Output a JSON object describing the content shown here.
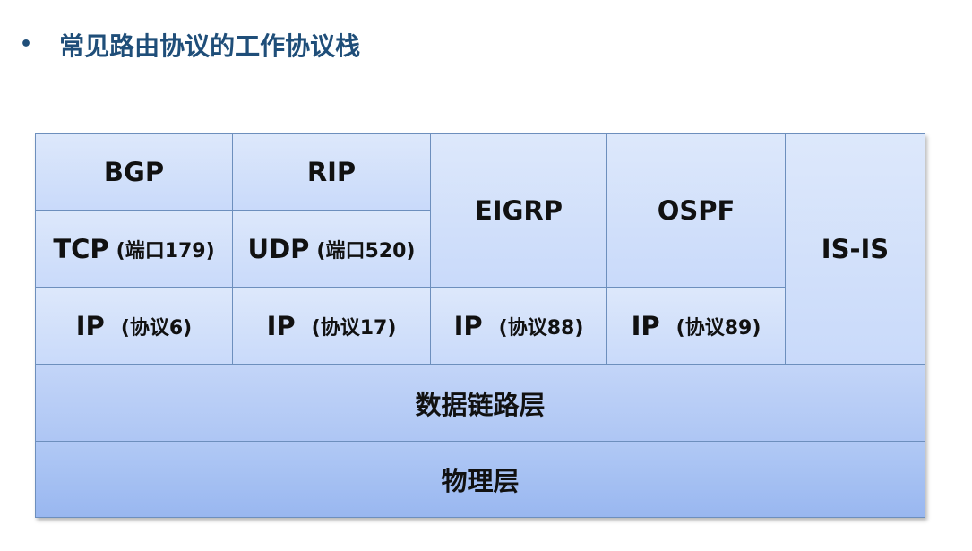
{
  "title": {
    "bullet": "•",
    "text": "常见路由协议的工作协议栈"
  },
  "stack": {
    "bgp": "BGP",
    "rip": "RIP",
    "eigrp": "EIGRP",
    "ospf": "OSPF",
    "isis": "IS-IS",
    "tcp": {
      "main": "TCP",
      "note": "(端口179)"
    },
    "udp": {
      "main": "UDP",
      "note": "(端口520)"
    },
    "ip_bgp": {
      "main": "IP",
      "note": "(协议6)"
    },
    "ip_rip": {
      "main": "IP",
      "note": "(协议17)"
    },
    "ip_eigrp": {
      "main": "IP",
      "note": "(协议88)"
    },
    "ip_ospf": {
      "main": "IP",
      "note": "(协议89)"
    },
    "datalink": "数据链路层",
    "physical": "物理层"
  }
}
